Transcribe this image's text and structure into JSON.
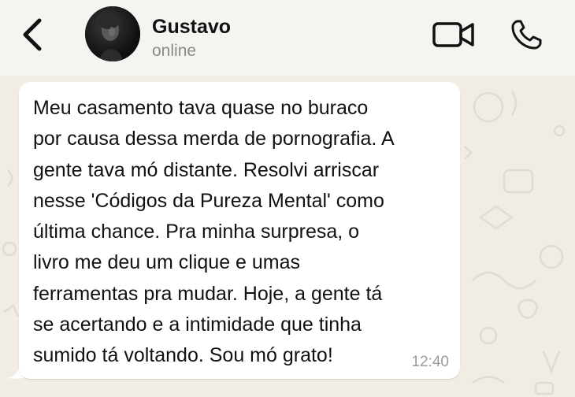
{
  "header": {
    "contact_name": "Gustavo",
    "contact_status": "online",
    "back_icon": "chevron-left-icon",
    "video_icon": "video-camera-icon",
    "call_icon": "phone-icon"
  },
  "messages": [
    {
      "text": "Meu casamento tava quase no buraco\npor causa dessa merda de pornografia. A\ngente tava mó distante. Resolvi arriscar\nnesse 'Códigos da Pureza Mental' como\núltima chance. Pra minha surpresa, o\nlivro me deu um clique e umas\nferramentas pra mudar. Hoje, a gente tá\nse acertando e a intimidade que tinha\nsumido tá voltando. Sou mó grato!",
      "time": "12:40",
      "direction": "incoming"
    }
  ],
  "colors": {
    "header_bg": "#f6f4f1",
    "chat_bg": "#f1ece4",
    "bubble_bg": "#ffffff",
    "muted_text": "#8a8a8a"
  }
}
